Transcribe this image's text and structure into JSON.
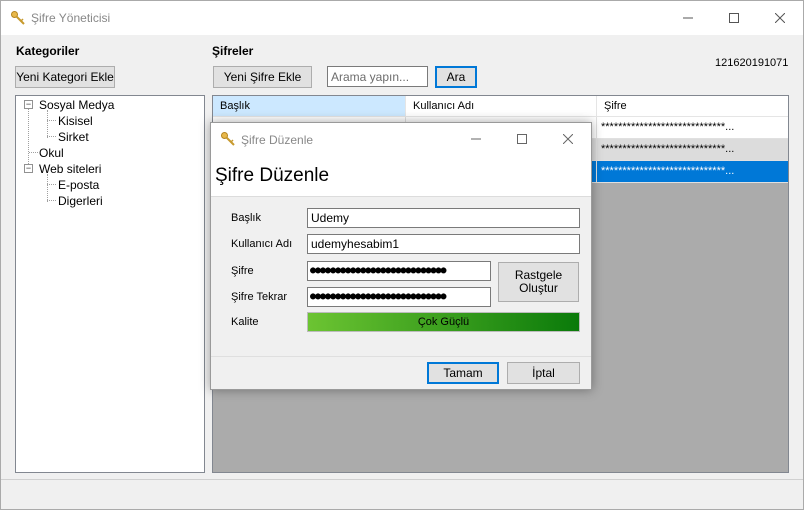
{
  "window": {
    "title": "Şifre Yöneticisi"
  },
  "categories": {
    "heading": "Kategoriler",
    "add_button": "Yeni Kategori Ekle",
    "tree": [
      {
        "label": "Sosyal Medya",
        "expander": "−"
      },
      {
        "label": "Kisisel"
      },
      {
        "label": "Sirket"
      },
      {
        "label": "Okul"
      },
      {
        "label": "Web siteleri",
        "expander": "−"
      },
      {
        "label": "E-posta"
      },
      {
        "label": "Digerleri"
      }
    ]
  },
  "passwords": {
    "heading": "Şifreler",
    "add_button": "Yeni Şifre Ekle",
    "search_placeholder": "Arama yapın...",
    "search_button": "Ara",
    "counter": "121620191071",
    "columns": [
      "Başlık",
      "Kullanıcı Adı",
      "Şifre"
    ],
    "rows": [
      {
        "password": "*****************************..."
      },
      {
        "password": "*****************************..."
      },
      {
        "password": "*****************************..."
      }
    ]
  },
  "dialog": {
    "title": "Şifre Düzenle",
    "heading": "Şifre Düzenle",
    "fields": {
      "title_label": "Başlık",
      "title_value": "Udemy",
      "username_label": "Kullanıcı Adı",
      "username_value": "udemyhesabim1",
      "password_label": "Şifre",
      "password_value": "●●●●●●●●●●●●●●●●●●●●●●●●●●●",
      "password_repeat_label": "Şifre Tekrar",
      "password_repeat_value": "●●●●●●●●●●●●●●●●●●●●●●●●●●●"
    },
    "generate_button": "Rastgele Oluştur",
    "quality_label": "Kalite",
    "quality_text": "Çok Güçlü",
    "quality_fraction": 1.0,
    "ok_button": "Tamam",
    "cancel_button": "İptal"
  },
  "icons": {
    "app": "key-icon",
    "minimize": "minimize-icon",
    "maximize": "maximize-icon",
    "close": "close-icon"
  },
  "colors": {
    "accent": "#0078d7",
    "quality_start": "#6cc432",
    "quality_end": "#0a7a0a"
  }
}
